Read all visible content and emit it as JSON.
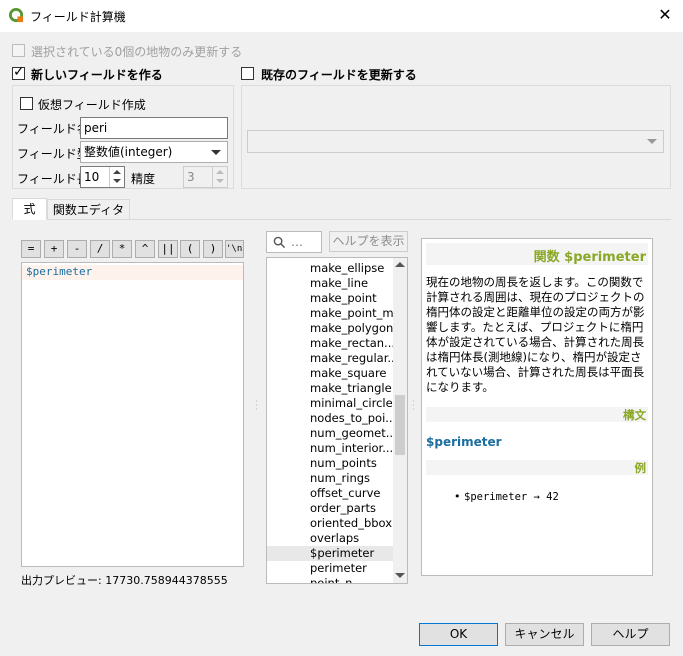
{
  "window": {
    "title": "フィールド計算機",
    "close_glyph": "✕"
  },
  "only_selected": {
    "label": "選択されている0個の地物のみ更新する",
    "checked": false,
    "enabled": false
  },
  "new_field": {
    "header_label": "新しいフィールドを作る",
    "checked": true,
    "virtual_label": "仮想フィールド作成",
    "name_label": "フィールド名",
    "name_value": "peri",
    "type_label": "フィールド型",
    "type_value": "整数値(integer)",
    "length_label": "フィールド長",
    "length_value": "10",
    "precision_label": "精度",
    "precision_value": "3"
  },
  "update_existing": {
    "header_label": "既存のフィールドを更新する",
    "checked": false,
    "combo_value": ""
  },
  "tabs": [
    {
      "label": "式",
      "active": true
    },
    {
      "label": "関数エディタ",
      "active": false
    }
  ],
  "operators": [
    "=",
    "+",
    "-",
    "/",
    "*",
    "^",
    "||",
    "(",
    ")",
    "'\\n'"
  ],
  "expression": "$perimeter",
  "preview": {
    "label": "出力プレビュー:",
    "value": "17730.758944378555"
  },
  "search": {
    "icon": "search-icon",
    "placeholder": "…"
  },
  "show_help_label": "ヘルプを表示",
  "functions": [
    "make_ellipse",
    "make_line",
    "make_point",
    "make_point_m",
    "make_polygon",
    "make_rectan...",
    "make_regular...",
    "make_square",
    "make_triangle",
    "minimal_circle",
    "nodes_to_poi...",
    "num_geomet...",
    "num_interior...",
    "num_points",
    "num_rings",
    "offset_curve",
    "order_parts",
    "oriented_bbox",
    "overlaps",
    "$perimeter",
    "perimeter",
    "point_n"
  ],
  "selected_function_index": 19,
  "help": {
    "title": "関数 $perimeter",
    "description": "現在の地物の周長を返します。この関数で計算される周囲は、現在のプロジェクトの楕円体の設定と距離単位の設定の両方が影響します。たとえば、プロジェクトに楕円体が設定されている場合、計算された周長は楕円体長(測地線)になり、楕円が設定されていない場合、計算された周長は平面長になります。",
    "syntax_header": "構文",
    "syntax": "$perimeter",
    "examples_header": "例",
    "example": "$perimeter → 42"
  },
  "buttons": {
    "ok": "OK",
    "cancel": "キャンセル",
    "help": "ヘルプ"
  },
  "colors": {
    "help_title": "#8aa826",
    "syntax": "#1b6da0",
    "focus": "#0078d7"
  }
}
